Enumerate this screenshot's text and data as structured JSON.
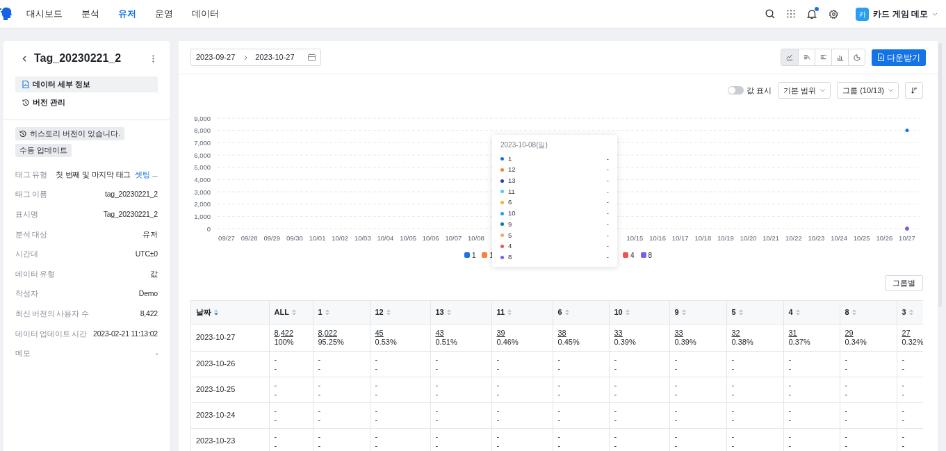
{
  "nav": {
    "items": [
      {
        "label": "대시보드",
        "selected": false
      },
      {
        "label": "분석",
        "selected": false
      },
      {
        "label": "유저",
        "selected": true
      },
      {
        "label": "운영",
        "selected": false
      },
      {
        "label": "데이터",
        "selected": false
      }
    ],
    "notification_dot": true,
    "avatar": "카",
    "project": "카드 게임 데모"
  },
  "sidebar": {
    "title": "Tag_20230221_2",
    "menu": [
      {
        "label": "데이터 세부 정보",
        "selected": true
      },
      {
        "label": "버전 관리",
        "selected": false
      }
    ],
    "badges": [
      {
        "label": "히스토리 버전이 있습니다.",
        "kind": "notice"
      },
      {
        "label": "수동 업데이트",
        "kind": "plain"
      }
    ],
    "tag_type": {
      "label": "태그 유형",
      "value": "첫 번째 및 마지막 태그",
      "link": "셋팅",
      "more": "..."
    },
    "properties": [
      {
        "label": "태그 이름",
        "value": "tag_20230221_2"
      },
      {
        "label": "표시명",
        "value": "Tag_20230221_2"
      },
      {
        "label": "분석 대상",
        "value": "유저"
      },
      {
        "label": "시간대",
        "value": "UTC±0"
      },
      {
        "label": "데이터 유형",
        "value": "값"
      },
      {
        "label": "작성자",
        "value": "Demo"
      },
      {
        "label": "최신 버전의 사용자 수",
        "value": "8,422"
      },
      {
        "label": "데이터 업데이트 시간",
        "value": "2023-02-21 11:13:02"
      },
      {
        "label": "메모",
        "value": "-"
      }
    ]
  },
  "toolbar": {
    "date_start": "2023-09-27",
    "date_end": "2023-10-27",
    "chart_types": [
      {
        "kind": "line",
        "selected": true
      },
      {
        "kind": "hbar",
        "selected": false
      },
      {
        "kind": "hbar2",
        "selected": false
      },
      {
        "kind": "bar",
        "selected": false
      },
      {
        "kind": "pie",
        "selected": false
      }
    ],
    "download": "다운받기"
  },
  "controls": {
    "show_values": {
      "label": "값 표시",
      "on": false
    },
    "range": "기본 범위",
    "group": "그룹 (10/13)"
  },
  "chart": {
    "chart_data": {
      "type": "line",
      "grid": true,
      "categories": [
        "09/27",
        "09/28",
        "09/29",
        "09/30",
        "10/01",
        "10/02",
        "10/03",
        "10/04",
        "10/05",
        "10/06",
        "10/07",
        "10/08",
        null,
        null,
        null,
        null,
        null,
        null,
        "10/15",
        "10/16",
        "10/17",
        "10/18",
        "10/19",
        "10/20",
        "10/21",
        "10/22",
        "10/23",
        "10/24",
        "10/25",
        "10/26",
        "10/27"
      ],
      "ylim": [
        0,
        9000
      ],
      "yticks": [
        {
          "value": 0,
          "label": "0"
        },
        {
          "value": 1000,
          "label": "1,000"
        },
        {
          "value": 2000,
          "label": "2,000"
        },
        {
          "value": 3000,
          "label": "3,000"
        },
        {
          "value": 4000,
          "label": "4,000"
        },
        {
          "value": 5000,
          "label": "5,000"
        },
        {
          "value": 6000,
          "label": "6,000"
        },
        {
          "value": 7000,
          "label": "7,000"
        },
        {
          "value": 8000,
          "label": "8,000"
        },
        {
          "value": 9000,
          "label": "9,000"
        }
      ],
      "series": [
        {
          "name": "1",
          "color": "#1f6fe5",
          "marker": "circle",
          "values": [
            null,
            null,
            null,
            null,
            null,
            null,
            null,
            null,
            null,
            null,
            null,
            null,
            null,
            null,
            null,
            null,
            null,
            null,
            null,
            null,
            null,
            null,
            null,
            null,
            null,
            null,
            null,
            null,
            null,
            null,
            8000
          ]
        },
        {
          "name": "12",
          "color": "#f5813a",
          "marker": "circle",
          "values": [
            null,
            null,
            null,
            null,
            null,
            null,
            null,
            null,
            null,
            null,
            null,
            null,
            null,
            null,
            null,
            null,
            null,
            null,
            null,
            null,
            null,
            null,
            null,
            null,
            null,
            null,
            null,
            null,
            null,
            null,
            0
          ]
        },
        {
          "name": "13",
          "color": "#2e3fa8",
          "marker": "circle",
          "values": [
            null,
            null,
            null,
            null,
            null,
            null,
            null,
            null,
            null,
            null,
            null,
            null,
            null,
            null,
            null,
            null,
            null,
            null,
            null,
            null,
            null,
            null,
            null,
            null,
            null,
            null,
            null,
            null,
            null,
            null,
            0
          ]
        },
        {
          "name": "11",
          "color": "#4fd1d9",
          "marker": "circle",
          "values": [
            null,
            null,
            null,
            null,
            null,
            null,
            null,
            null,
            null,
            null,
            null,
            null,
            null,
            null,
            null,
            null,
            null,
            null,
            null,
            null,
            null,
            null,
            null,
            null,
            null,
            null,
            null,
            null,
            null,
            null,
            0
          ]
        },
        {
          "name": "6",
          "color": "#f7b32b",
          "marker": "circle",
          "values": [
            null,
            null,
            null,
            null,
            null,
            null,
            null,
            null,
            null,
            null,
            null,
            null,
            null,
            null,
            null,
            null,
            null,
            null,
            null,
            null,
            null,
            null,
            null,
            null,
            null,
            null,
            null,
            null,
            null,
            null,
            0
          ]
        },
        {
          "name": "10",
          "color": "#1aa3f5",
          "marker": "circle",
          "values": [
            null,
            null,
            null,
            null,
            null,
            null,
            null,
            null,
            null,
            null,
            null,
            null,
            null,
            null,
            null,
            null,
            null,
            null,
            null,
            null,
            null,
            null,
            null,
            null,
            null,
            null,
            null,
            null,
            null,
            null,
            0
          ]
        },
        {
          "name": "9",
          "color": "#0f7b84",
          "marker": "circle",
          "values": [
            null,
            null,
            null,
            null,
            null,
            null,
            null,
            null,
            null,
            null,
            null,
            null,
            null,
            null,
            null,
            null,
            null,
            null,
            null,
            null,
            null,
            null,
            null,
            null,
            null,
            null,
            null,
            null,
            null,
            null,
            0
          ]
        },
        {
          "name": "5",
          "color": "#f8a46a",
          "marker": "circle",
          "values": [
            null,
            null,
            null,
            null,
            null,
            null,
            null,
            null,
            null,
            null,
            null,
            null,
            null,
            null,
            null,
            null,
            null,
            null,
            null,
            null,
            null,
            null,
            null,
            null,
            null,
            null,
            null,
            null,
            null,
            null,
            0
          ]
        },
        {
          "name": "4",
          "color": "#ef5350",
          "marker": "circle",
          "values": [
            null,
            null,
            null,
            null,
            null,
            null,
            null,
            null,
            null,
            null,
            null,
            null,
            null,
            null,
            null,
            null,
            null,
            null,
            null,
            null,
            null,
            null,
            null,
            null,
            null,
            null,
            null,
            null,
            null,
            null,
            0
          ]
        },
        {
          "name": "8",
          "color": "#7b5cf5",
          "marker": "circle",
          "values": [
            null,
            null,
            null,
            null,
            null,
            null,
            null,
            null,
            null,
            null,
            null,
            null,
            null,
            null,
            null,
            null,
            null,
            null,
            null,
            null,
            null,
            null,
            null,
            null,
            null,
            null,
            null,
            null,
            null,
            null,
            0
          ]
        }
      ]
    },
    "legend_left": [
      {
        "label": "1",
        "color": "#1f6fe5"
      },
      {
        "label": "1",
        "color": "#f5813a"
      }
    ],
    "legend_right": [
      {
        "label": "4",
        "color": "#ef5350"
      },
      {
        "label": "8",
        "color": "#7b5cf5"
      }
    ],
    "tooltip": {
      "title": "2023-10-08(일)",
      "values": [
        "-",
        "-",
        "-",
        "-",
        "-",
        "-",
        "-",
        "-",
        "-",
        "-"
      ]
    }
  },
  "group_button": "그룹별",
  "table": {
    "columns": [
      {
        "label": "날짜",
        "sorted": true
      },
      {
        "label": "ALL",
        "sorted": false
      },
      {
        "label": "1",
        "sorted": false
      },
      {
        "label": "12",
        "sorted": false
      },
      {
        "label": "13",
        "sorted": false
      },
      {
        "label": "11",
        "sorted": false
      },
      {
        "label": "6",
        "sorted": false
      },
      {
        "label": "10",
        "sorted": false
      },
      {
        "label": "9",
        "sorted": false
      },
      {
        "label": "5",
        "sorted": false
      },
      {
        "label": "4",
        "sorted": false
      },
      {
        "label": "8",
        "sorted": false
      },
      {
        "label": "3",
        "sorted": false
      }
    ],
    "rows": [
      {
        "cells": [
          "2023-10-27",
          [
            "8,422",
            "100%"
          ],
          [
            "8,022",
            "95.25%"
          ],
          [
            "45",
            "0.53%"
          ],
          [
            "43",
            "0.51%"
          ],
          [
            "39",
            "0.46%"
          ],
          [
            "38",
            "0.45%"
          ],
          [
            "33",
            "0.39%"
          ],
          [
            "33",
            "0.39%"
          ],
          [
            "32",
            "0.38%"
          ],
          [
            "31",
            "0.37%"
          ],
          [
            "29",
            "0.34%"
          ],
          [
            "27",
            "0.32%"
          ]
        ]
      },
      {
        "cells": [
          "2023-10-26",
          [
            "-",
            "-"
          ],
          [
            "-",
            "-"
          ],
          [
            "-",
            "-"
          ],
          [
            "-",
            "-"
          ],
          [
            "-",
            "-"
          ],
          [
            "-",
            "-"
          ],
          [
            "-",
            "-"
          ],
          [
            "-",
            "-"
          ],
          [
            "-",
            "-"
          ],
          [
            "-",
            "-"
          ],
          [
            "-",
            "-"
          ],
          [
            "-",
            "-"
          ]
        ]
      },
      {
        "cells": [
          "2023-10-25",
          [
            "-",
            "-"
          ],
          [
            "-",
            "-"
          ],
          [
            "-",
            "-"
          ],
          [
            "-",
            "-"
          ],
          [
            "-",
            "-"
          ],
          [
            "-",
            "-"
          ],
          [
            "-",
            "-"
          ],
          [
            "-",
            "-"
          ],
          [
            "-",
            "-"
          ],
          [
            "-",
            "-"
          ],
          [
            "-",
            "-"
          ],
          [
            "-",
            "-"
          ]
        ]
      },
      {
        "cells": [
          "2023-10-24",
          [
            "-",
            "-"
          ],
          [
            "-",
            "-"
          ],
          [
            "-",
            "-"
          ],
          [
            "-",
            "-"
          ],
          [
            "-",
            "-"
          ],
          [
            "-",
            "-"
          ],
          [
            "-",
            "-"
          ],
          [
            "-",
            "-"
          ],
          [
            "-",
            "-"
          ],
          [
            "-",
            "-"
          ],
          [
            "-",
            "-"
          ],
          [
            "-",
            "-"
          ]
        ]
      },
      {
        "cells": [
          "2023-10-23",
          [
            "-",
            "-"
          ],
          [
            "-",
            "-"
          ],
          [
            "-",
            "-"
          ],
          [
            "-",
            "-"
          ],
          [
            "-",
            "-"
          ],
          [
            "-",
            "-"
          ],
          [
            "-",
            "-"
          ],
          [
            "-",
            "-"
          ],
          [
            "-",
            "-"
          ],
          [
            "-",
            "-"
          ],
          [
            "-",
            "-"
          ],
          [
            "-",
            "-"
          ]
        ]
      }
    ]
  }
}
